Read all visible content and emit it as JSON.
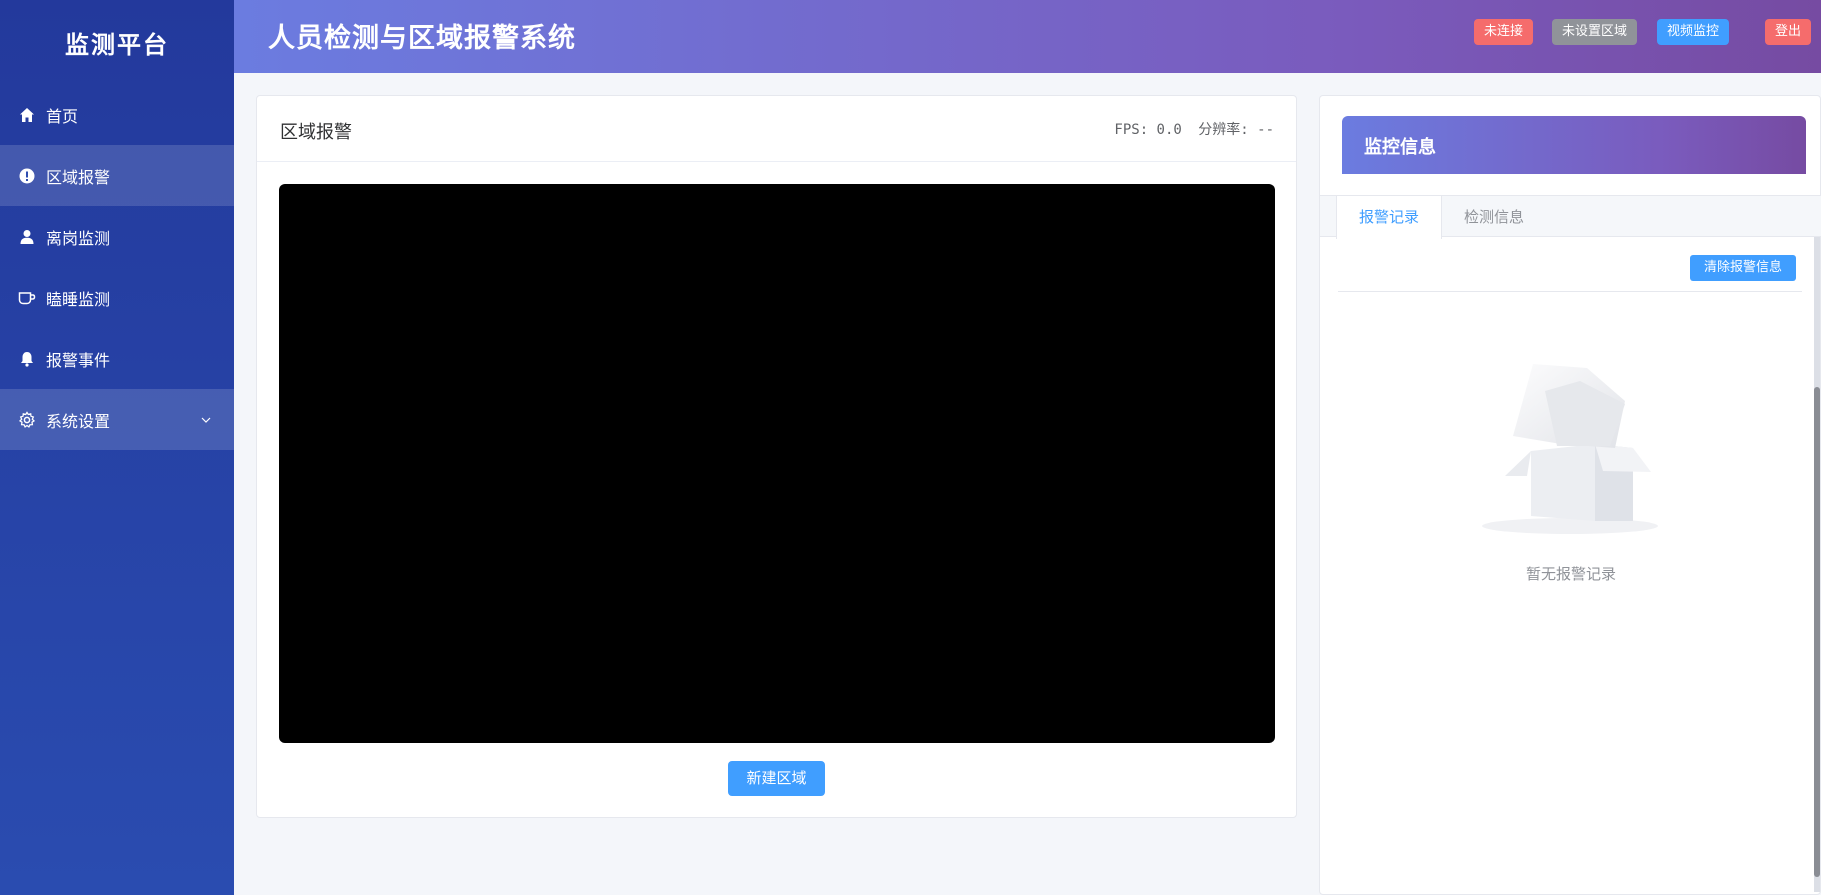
{
  "sidebar": {
    "brand": "监测平台",
    "items": [
      {
        "label": "首页",
        "icon": "home-icon"
      },
      {
        "label": "区域报警",
        "icon": "exclamation-circle-icon"
      },
      {
        "label": "离岗监测",
        "icon": "user-icon"
      },
      {
        "label": "瞌睡监测",
        "icon": "coffee-cup-icon"
      },
      {
        "label": "报警事件",
        "icon": "bell-icon"
      },
      {
        "label": "系统设置",
        "icon": "gear-icon"
      }
    ]
  },
  "header": {
    "title": "人员检测与区域报警系统",
    "tags": {
      "connection": "未连接",
      "region": "未设置区域",
      "video_monitor": "视频监控",
      "logout": "登出"
    }
  },
  "video_card": {
    "title": "区域报警",
    "fps": "FPS: 0.0",
    "resolution": "分辨率: --",
    "new_region_label": "新建区域"
  },
  "panel": {
    "title": "监控信息",
    "tabs": [
      "报警记录",
      "检测信息"
    ],
    "clear_label": "清除报警信息",
    "empty_text": "暂无报警记录"
  },
  "colors": {
    "sidebar": "#23399c",
    "header_start": "#6b7ce0",
    "header_end": "#764ba2",
    "primary": "#409eff",
    "danger": "#f56c6c",
    "info": "#909399"
  }
}
